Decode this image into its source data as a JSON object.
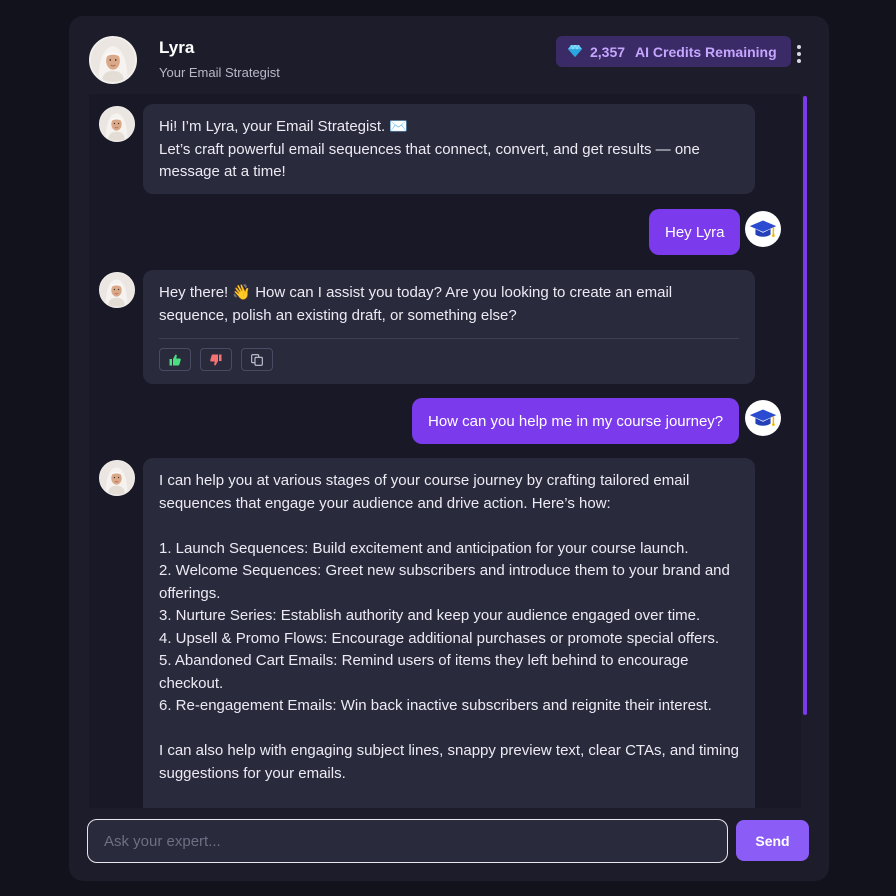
{
  "header": {
    "name": "Lyra",
    "role": "Your Email Strategist",
    "credits_value": "2,357",
    "credits_label": "AI Credits Remaining",
    "credits_icon": "gem-icon",
    "menu_icon": "more-vertical-icon"
  },
  "messages": [
    {
      "from": "bot",
      "lines": [
        "Hi! I’m Lyra, your Email Strategist. ✉️",
        "Let’s craft powerful email sequences that connect, convert, and get results — one",
        "message at a time!"
      ]
    },
    {
      "from": "user",
      "text": "Hey Lyra"
    },
    {
      "from": "bot",
      "lines": [
        "Hey there! 👋 How can I assist you today? Are you looking to create an email",
        "sequence, polish an existing draft, or something else?"
      ],
      "feedback": [
        "thumbs-up-icon",
        "thumbs-down-icon",
        "copy-icon"
      ]
    },
    {
      "from": "user",
      "text": "How can you help me in my course journey?"
    },
    {
      "from": "bot",
      "lines": [
        "I can help you at various stages of your course journey by crafting tailored email",
        "sequences that engage your audience and drive action. Here’s how:",
        "",
        "1. Launch Sequences: Build excitement and anticipation for your course launch.",
        "2. Welcome Sequences: Greet new subscribers and introduce them to your brand and",
        "offerings.",
        "3. Nurture Series: Establish authority and keep your audience engaged over time.",
        "4. Upsell & Promo Flows: Encourage additional purchases or promote special offers.",
        "5. Abandoned Cart Emails: Remind users of items they left behind to encourage",
        "checkout.",
        "6. Re-engagement Emails: Win back inactive subscribers and reignite their interest.",
        "",
        "I can also help with engaging subject lines, snappy preview text, clear CTAs, and timing",
        "suggestions for your emails."
      ]
    }
  ],
  "composer": {
    "placeholder": "Ask your expert...",
    "send_label": "Send"
  },
  "colors": {
    "accent": "#7c3aed",
    "send": "#8b5cf6",
    "credits_bg": "#3a2a66",
    "credits_text": "#c6a5ff",
    "bubble_bot": "#2a2a3d",
    "panel": "#1c1c2a"
  }
}
